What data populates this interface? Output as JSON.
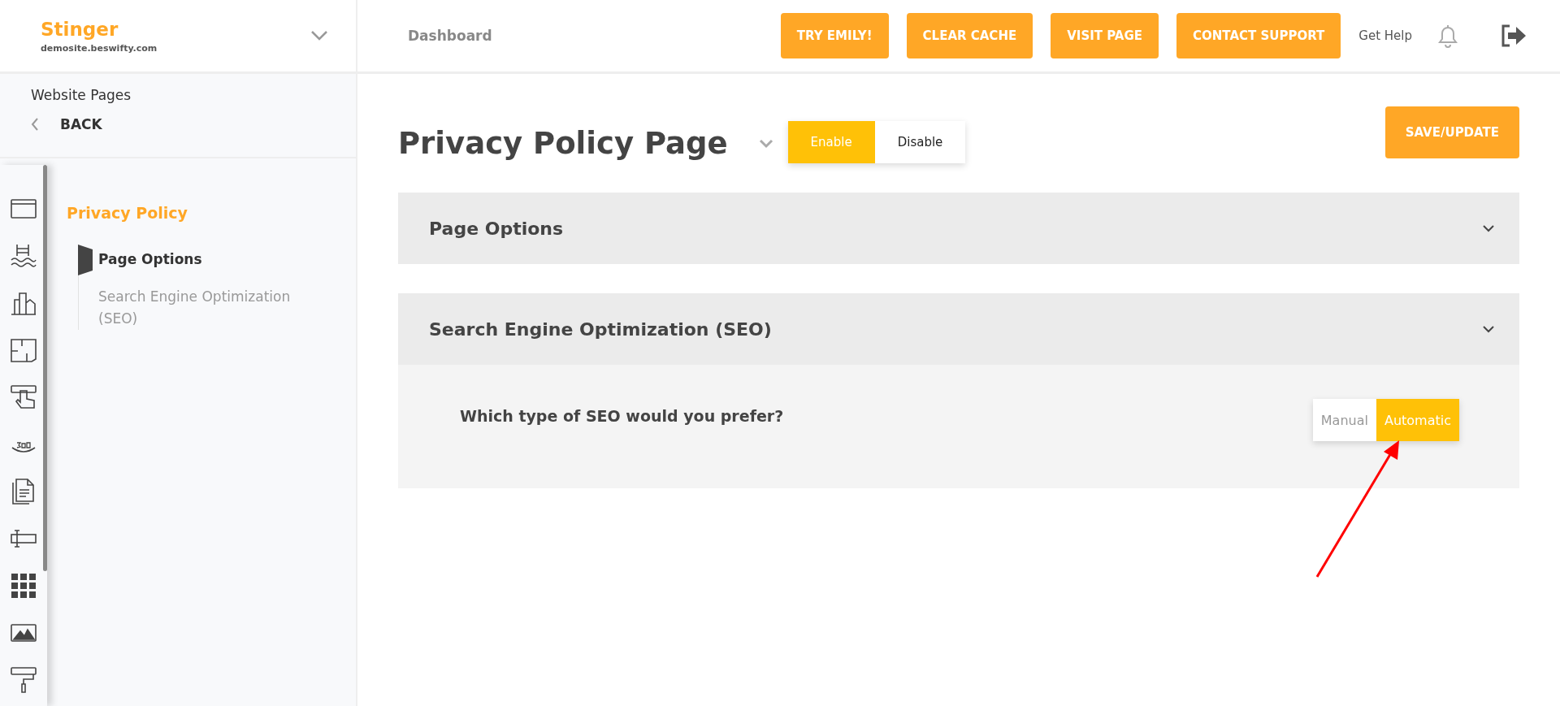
{
  "brand": {
    "name": "Stinger",
    "domain": "demosite.beswifty.com"
  },
  "topbar": {
    "breadcrumb": "Dashboard",
    "buttons": [
      "TRY EMILY!",
      "CLEAR CACHE",
      "VISIT PAGE",
      "CONTACT SUPPORT"
    ],
    "help": "Get Help"
  },
  "sidebar": {
    "heading": "Website Pages",
    "back": "BACK",
    "section": "Privacy Policy",
    "items": [
      {
        "label": "Page Options",
        "selected": true
      },
      {
        "label": "Search Engine Optimization (SEO)",
        "selected": false
      }
    ]
  },
  "page": {
    "title": "Privacy Policy Page",
    "status": [
      {
        "label": "Enable",
        "selected": true
      },
      {
        "label": "Disable",
        "selected": false
      }
    ],
    "save": "SAVE/UPDATE",
    "panels": [
      {
        "title": "Page Options",
        "expanded": false
      },
      {
        "title": "Search Engine Optimization (SEO)",
        "expanded": true,
        "question": "Which type of SEO would you prefer?",
        "options": [
          {
            "label": "Manual",
            "selected": false
          },
          {
            "label": "Automatic",
            "selected": true
          }
        ]
      }
    ]
  }
}
